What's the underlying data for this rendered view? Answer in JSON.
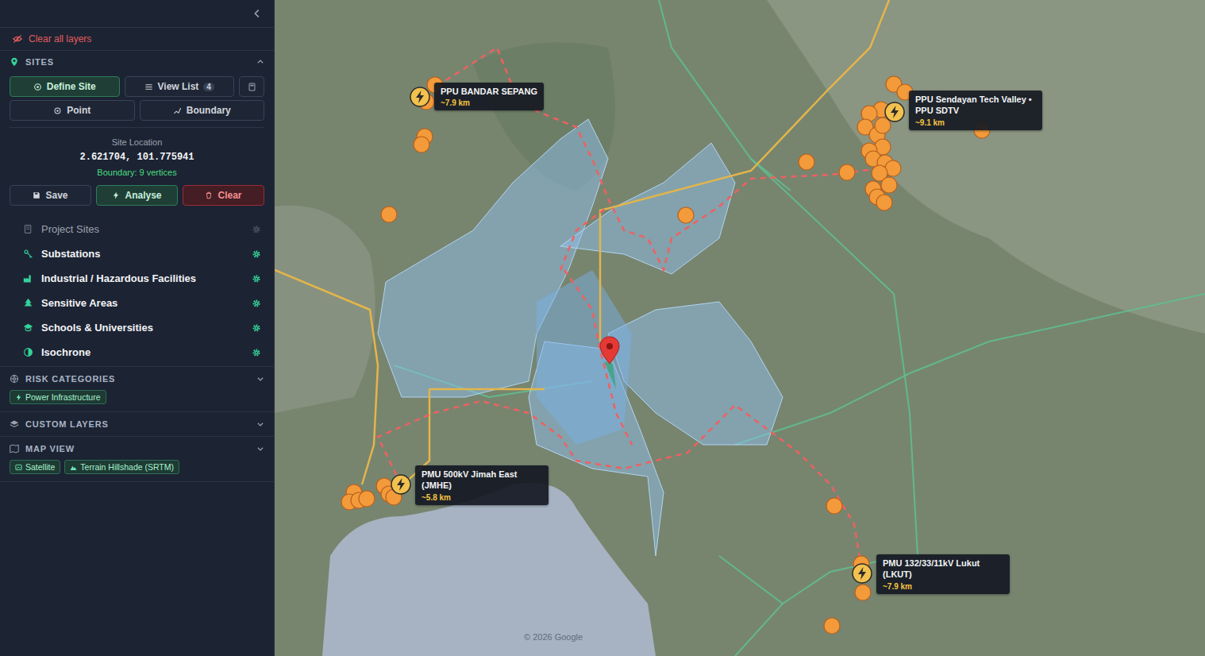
{
  "sidebar": {
    "clear_all": "Clear all layers",
    "sites": {
      "title": "SITES",
      "expanded": true,
      "tabs": [
        {
          "label": "Define Site",
          "badge": "",
          "selected": true
        },
        {
          "label": "View List",
          "badge": "4",
          "selected": false
        }
      ],
      "modes": [
        {
          "label": "Point",
          "selected": false
        },
        {
          "label": "Boundary",
          "selected": false
        }
      ],
      "site_location_label": "Site Location",
      "coordinates": "2.621704, 101.775941",
      "boundary": "Boundary: 9 vertices",
      "actions": [
        {
          "label": "Save",
          "kind": "neutral"
        },
        {
          "label": "Analyse",
          "kind": "primary"
        },
        {
          "label": "Clear",
          "kind": "danger"
        }
      ],
      "layers": [
        {
          "label": "Project Sites",
          "enabled": false
        },
        {
          "label": "Substations",
          "enabled": true
        },
        {
          "label": "Industrial / Hazardous Facilities",
          "enabled": true
        },
        {
          "label": "Sensitive Areas",
          "enabled": true
        },
        {
          "label": "Schools & Universities",
          "enabled": true
        },
        {
          "label": "Isochrone",
          "enabled": true
        }
      ]
    },
    "sections": [
      {
        "title": "RISK CATEGORIES",
        "expanded": false,
        "chips": [
          "Power Infrastructure"
        ]
      },
      {
        "title": "CUSTOM LAYERS",
        "expanded": false,
        "chips": []
      },
      {
        "title": "MAP VIEW",
        "expanded": false,
        "chips": [
          "Satellite",
          "Terrain Hillshade (SRTM)"
        ]
      }
    ]
  },
  "map": {
    "attribution": "© 2026 Google",
    "substations": [
      {
        "name": "PPU BANDAR SEPANG",
        "distance": "~7.9 km"
      },
      {
        "name": "PPU Sendayan Tech Valley • PPU SDTV",
        "distance": "~9.1 km"
      },
      {
        "name": "PMU 500kV Jimah East (JMHE)",
        "distance": "~5.8 km"
      },
      {
        "name": "PMU 132/33/11kV Lukut (LKUT)",
        "distance": "~7.9 km"
      }
    ]
  }
}
